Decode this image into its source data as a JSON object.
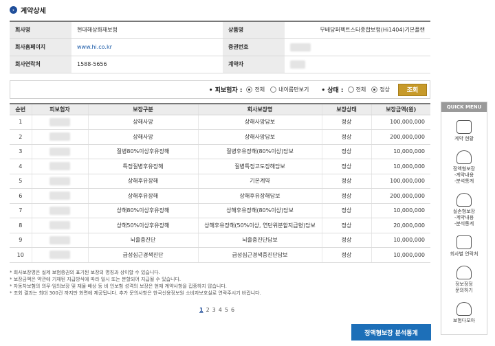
{
  "title": "계약상세",
  "info": {
    "rows": [
      {
        "l1": "회사명",
        "v1": "현대해상화재보험",
        "l2": "상품명",
        "v2": "무배당퍼펙트스타종합보험(Hi1404)기본플랜"
      },
      {
        "l1": "회사홈페이지",
        "v1": "www.hi.co.kr",
        "l2": "증권번호",
        "v2": ""
      },
      {
        "l1": "회사연락처",
        "v1": "1588-5656",
        "l2": "계약자",
        "v2": ""
      }
    ]
  },
  "filter": {
    "insured_label": "• 피보험자 :",
    "insured_all": "전체",
    "insured_mine": "내이름만보기",
    "status_label": "• 상태 :",
    "status_all": "전체",
    "status_normal": "정상",
    "search_button": "조회"
  },
  "list": {
    "headers": [
      "순번",
      "피보험자",
      "보장구분",
      "회사보장명",
      "보장상태",
      "보장금액(원)"
    ],
    "rows": [
      {
        "no": "1",
        "type": "상해사망",
        "name": "상해사망담보",
        "status": "정상",
        "amount": "100,000,000"
      },
      {
        "no": "2",
        "type": "상해사망",
        "name": "상해사망담보",
        "status": "정상",
        "amount": "200,000,000"
      },
      {
        "no": "3",
        "type": "질병80%이상후유장해",
        "name": "질병후유장해(80%이상)담보",
        "status": "정상",
        "amount": "10,000,000"
      },
      {
        "no": "4",
        "type": "특정질병후유장해",
        "name": "질병특정고도장해담보",
        "status": "정상",
        "amount": "10,000,000"
      },
      {
        "no": "5",
        "type": "상해후유장해",
        "name": "기본계약",
        "status": "정상",
        "amount": "100,000,000"
      },
      {
        "no": "6",
        "type": "상해후유장해",
        "name": "상해후유장해담보",
        "status": "정상",
        "amount": "200,000,000"
      },
      {
        "no": "7",
        "type": "상해80%이상후유장해",
        "name": "상해후유장해(80%이상)담보",
        "status": "정상",
        "amount": "10,000,000"
      },
      {
        "no": "8",
        "type": "상해50%이상후유장해",
        "name": "상해후유장해(50%이상, 연단위분할지급형)담보",
        "status": "정상",
        "amount": "20,000,000"
      },
      {
        "no": "9",
        "type": "뇌졸중진단",
        "name": "뇌졸중진단담보",
        "status": "정상",
        "amount": "10,000,000"
      },
      {
        "no": "10",
        "type": "급성심근경색진단",
        "name": "급성심근경색증진단담보",
        "status": "정상",
        "amount": "10,000,000"
      }
    ]
  },
  "notes": [
    "* 회사보장명은 실제 보험증권의 표기된 보장의 명칭과 상이할 수 있습니다.",
    "* 보장금액은 약관에 기재된 지급방식에 따라 일시 또는 분할되어 지급될 수 있습니다.",
    "* 자동차보험의 의무·임의보장 및 재물·배상 등 비 인보험 성격의 보장은 현재 계약사항을 집중하지 않습니다.",
    "* 조회 결과는 최대 300건 까지만 화면에 제공됩니다. 추가 문의사항은 한국신용정보원 소비자보호실로 연락주시기 바랍니다."
  ],
  "pager": [
    "1",
    "2",
    "3",
    "4",
    "5",
    "6"
  ],
  "analysis_button": "정액형보장 분석통계",
  "quick_menu": {
    "title": "QUICK MENU",
    "items": [
      {
        "label": "계약 현황"
      },
      {
        "label": "정액형보장\n-계약내용\n-분석통계"
      },
      {
        "label": "실손형보장\n-계약내용\n-분석통계"
      },
      {
        "label": "회사별 연락처"
      },
      {
        "label": "정보정정\n문의하기"
      },
      {
        "label": "보험다모아"
      }
    ]
  }
}
